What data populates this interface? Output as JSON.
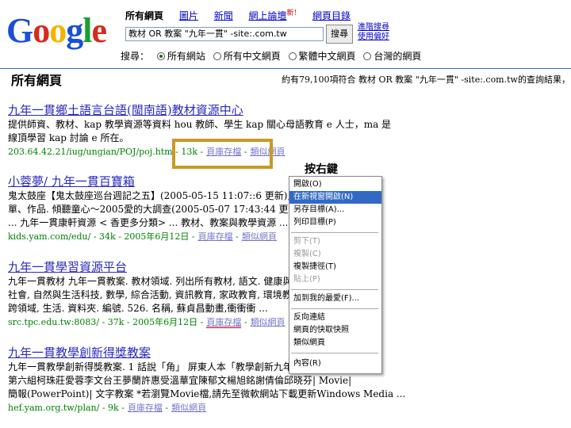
{
  "nav": {
    "current": "所有網頁",
    "images": "圖片",
    "news": "新聞",
    "groups": "網上論壇",
    "groups_badge": "新!",
    "directory": "網頁目錄"
  },
  "logo": {
    "text": "Google",
    "colors": [
      "#1a4fd6",
      "#d52b1e",
      "#f3b400",
      "#1a4fd6",
      "#1aa032",
      "#d52b1e"
    ]
  },
  "search": {
    "value": "教材 OR 教案 \"九年一貫\" -site:.com.tw",
    "button": "搜尋",
    "advanced": "進階搜尋",
    "preferences": "使用偏好"
  },
  "scope": {
    "label": "搜尋：",
    "options": [
      "所有網站",
      "所有中文網頁",
      "繁體中文網頁",
      "台灣的網頁"
    ],
    "selected": 0
  },
  "bar": {
    "title": "所有網頁",
    "info": "約有79,100項符合 教材 OR 教案 \"九年一貫\" -site:.com.tw的查詢結果，"
  },
  "results": [
    {
      "title": "九年一貫鄉土語言台語(閩南語)教材資源中心",
      "snippet1": "提供師資、教材、kap 教學資源等資料 hou 教師、學生 kap 關心母語教育 e 人士，ma 是",
      "snippet2": "線頂學習 kap 討論 e 所在。",
      "url": "203.64.42.21/iug/ungian/POJ/poj.htm - 13k -",
      "cache": "頁庫存檔",
      "similar": "類似網頁"
    },
    {
      "title": "小蓉夢/ 九年一貫百寶箱",
      "snippet1": "鬼太鼓座【鬼太鼓座巡台週記之五】(2005-05-15 11:07::6 更新), 藝術",
      "snippet2": "單、作品. 傾聽童心～2005愛的大調查(2005-05-07 17:43:44 更新), 親子",
      "snippet3": "... 九年一貫康軒資源 < 香更多分類> ... 教材、教案與教學資源 ...",
      "url": "kids.yam.com/edu/ - 34k - 2005年6月12日 -",
      "cache": "頁庫存檔",
      "similar": "類似網頁"
    },
    {
      "title": "九年一貫學習資源平台",
      "snippet1": "九年一貫教材 九年一貫教案. 教材領域. 列出所有教材, 語文. 健康與體",
      "snippet2": "社會, 自然與生活科技, 數學, 綜合活動, 資訊教育, 家政教育, 環境教育",
      "snippet3": "跨領域, 生活. 資料夾. 編號. 526. 名稱, 蘇貞昌動畫,衝衝衝 ...",
      "url": "src.tpc.edu.tw:8083/ - 37k - 2005年6月12日 -",
      "cache": "頁庫存檔",
      "similar": "類似網頁"
    },
    {
      "title": "九年一貫教學創新得獎教案",
      "snippet1": "九年一貫教學創新得獎教案. 1 話說「角」 屏東人本「教學創新九年一貫",
      "snippet2": "第六組柯珠莊愛蓉李文台王夢蘭許惠受溫華宜陳郁文楊旭銘謝倩倫邱晓芬| Movie|",
      "snippet3": "簡報(PowerPoint)| 文字教案 *若瀏覽Movie檔,請先至微軟網站下載更新Windows Media ...",
      "url": "hef.yam.org.tw/plan/ - 9k -",
      "cache": "頁庫存檔",
      "similar": "類似網頁"
    }
  ],
  "callout": "按右鍵",
  "context_menu": {
    "items": [
      {
        "label": "開啟(O)",
        "state": "normal"
      },
      {
        "label": "在新視窗開啟(N)",
        "state": "highlight"
      },
      {
        "label": "另存目標(A)...",
        "state": "normal"
      },
      {
        "label": "列印目標(P)",
        "state": "normal"
      },
      {
        "label": "剪下(T)",
        "state": "disabled"
      },
      {
        "label": "複製(C)",
        "state": "disabled"
      },
      {
        "label": "複製捷徑(T)",
        "state": "normal"
      },
      {
        "label": "貼上(P)",
        "state": "disabled"
      },
      {
        "label": "加到我的最愛(F)...",
        "state": "normal"
      },
      {
        "label": "反向連結",
        "state": "normal"
      },
      {
        "label": "網頁的快取快照",
        "state": "normal"
      },
      {
        "label": "類似網頁",
        "state": "normal"
      },
      {
        "label": "內容(R)",
        "state": "normal"
      }
    ]
  }
}
